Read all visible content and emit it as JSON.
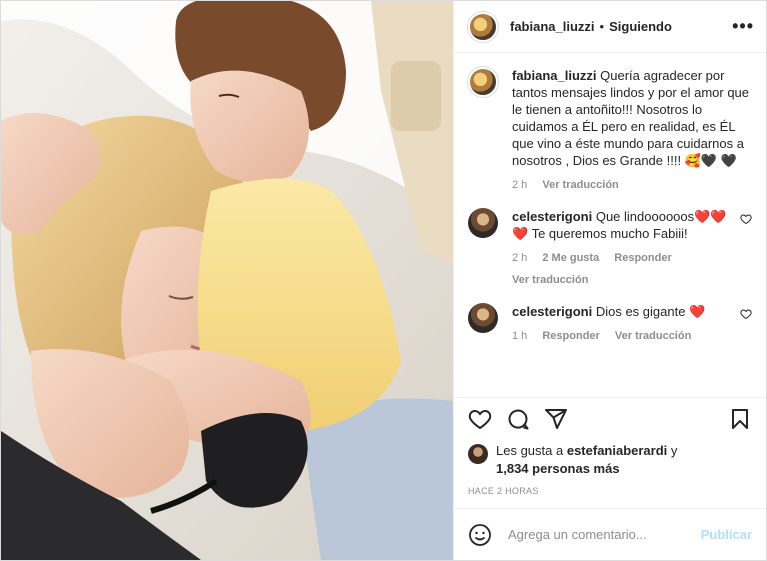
{
  "post": {
    "username": "fabiana_liuzzi",
    "separator": "•",
    "follow_status": "Siguiendo",
    "more_icon": "more-horizontal-icon",
    "photo_alt": "photo"
  },
  "caption": {
    "username": "fabiana_liuzzi",
    "text": "Quería agradecer por tantos mensajes lindos y por el amor que le tienen a antoñito!!! Nosotros lo cuidamos a ÉL pero en realidad, es ÉL que vino a éste mundo para cuidarnos a nosotros , Dios es Grande !!!! 🥰🖤 🖤",
    "time": "2 h",
    "translate": "Ver traducción"
  },
  "comments": [
    {
      "username": "celesterigoni",
      "text": "Que lindoooooos❤️❤️ ❤️ Te queremos mucho Fabiii!",
      "time": "2 h",
      "likes": "2 Me gusta",
      "reply": "Responder",
      "translate": "Ver traducción"
    },
    {
      "username": "celesterigoni",
      "text": "Dios es gigante ❤️",
      "time": "1 h",
      "reply": "Responder",
      "translate": "Ver traducción"
    }
  ],
  "actions": {
    "like_icon": "heart-icon",
    "comment_icon": "comment-icon",
    "share_icon": "share-icon",
    "save_icon": "bookmark-icon"
  },
  "likes": {
    "prefix": "Les gusta a",
    "user": "estefaniaberardi",
    "conj": "y",
    "count": "1,834 personas más"
  },
  "timestamp": "HACE 2 HORAS",
  "add_comment": {
    "placeholder": "Agrega un comentario...",
    "publish": "Publicar",
    "emoji_icon": "emoji-smile-icon"
  },
  "colors": {
    "heart_red": "#ed4956",
    "publish_disabled": "#b2dffc",
    "secondary_text": "#8e8e8e",
    "border": "#dbdbdb"
  }
}
